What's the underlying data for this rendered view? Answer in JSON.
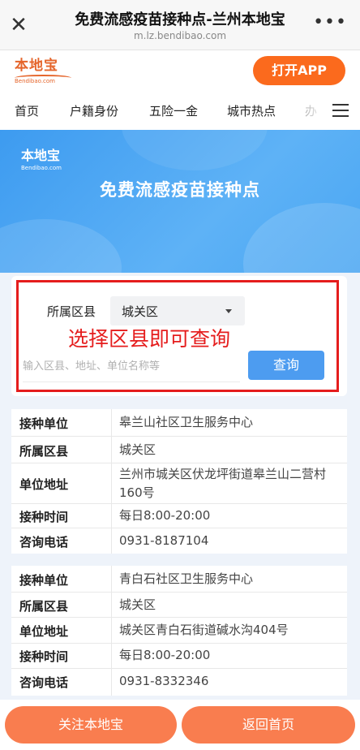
{
  "topbar": {
    "title": "免费流感疫苗接种点-兰州本地宝",
    "url": "m.lz.bendibao.com"
  },
  "brand": {
    "logo_cn": "本地宝",
    "logo_en": "Bendibao.com",
    "open_app": "打开APP",
    "accent_color": "#fb6a1d"
  },
  "nav": {
    "items": [
      "首页",
      "户籍身份",
      "五险一金",
      "城市热点",
      "办"
    ]
  },
  "banner": {
    "logo_cn": "本地宝",
    "logo_en": "Bendibao.com",
    "title": "免费流感疫苗接种点"
  },
  "search": {
    "district_label": "所属区县",
    "district_value": "城关区",
    "annotation": "选择区县即可查询",
    "placeholder": "输入区县、地址、单位名称等",
    "query_button": "查询"
  },
  "results": [
    {
      "rows": [
        {
          "key": "接种单位",
          "value": "皋兰山社区卫生服务中心"
        },
        {
          "key": "所属区县",
          "value": "城关区"
        },
        {
          "key": "单位地址",
          "value": "兰州市城关区伏龙坪街道皋兰山二营村160号"
        },
        {
          "key": "接种时间",
          "value": "每日8:00-20:00"
        },
        {
          "key": "咨询电话",
          "value": "0931-8187104"
        }
      ]
    },
    {
      "rows": [
        {
          "key": "接种单位",
          "value": "青白石社区卫生服务中心"
        },
        {
          "key": "所属区县",
          "value": "城关区"
        },
        {
          "key": "单位地址",
          "value": "城关区青白石街道碱水沟404号"
        },
        {
          "key": "接种时间",
          "value": "每日8:00-20:00"
        },
        {
          "key": "咨询电话",
          "value": "0931-8332346"
        }
      ]
    }
  ],
  "bottom": {
    "follow": "关注本地宝",
    "home": "返回首页"
  }
}
